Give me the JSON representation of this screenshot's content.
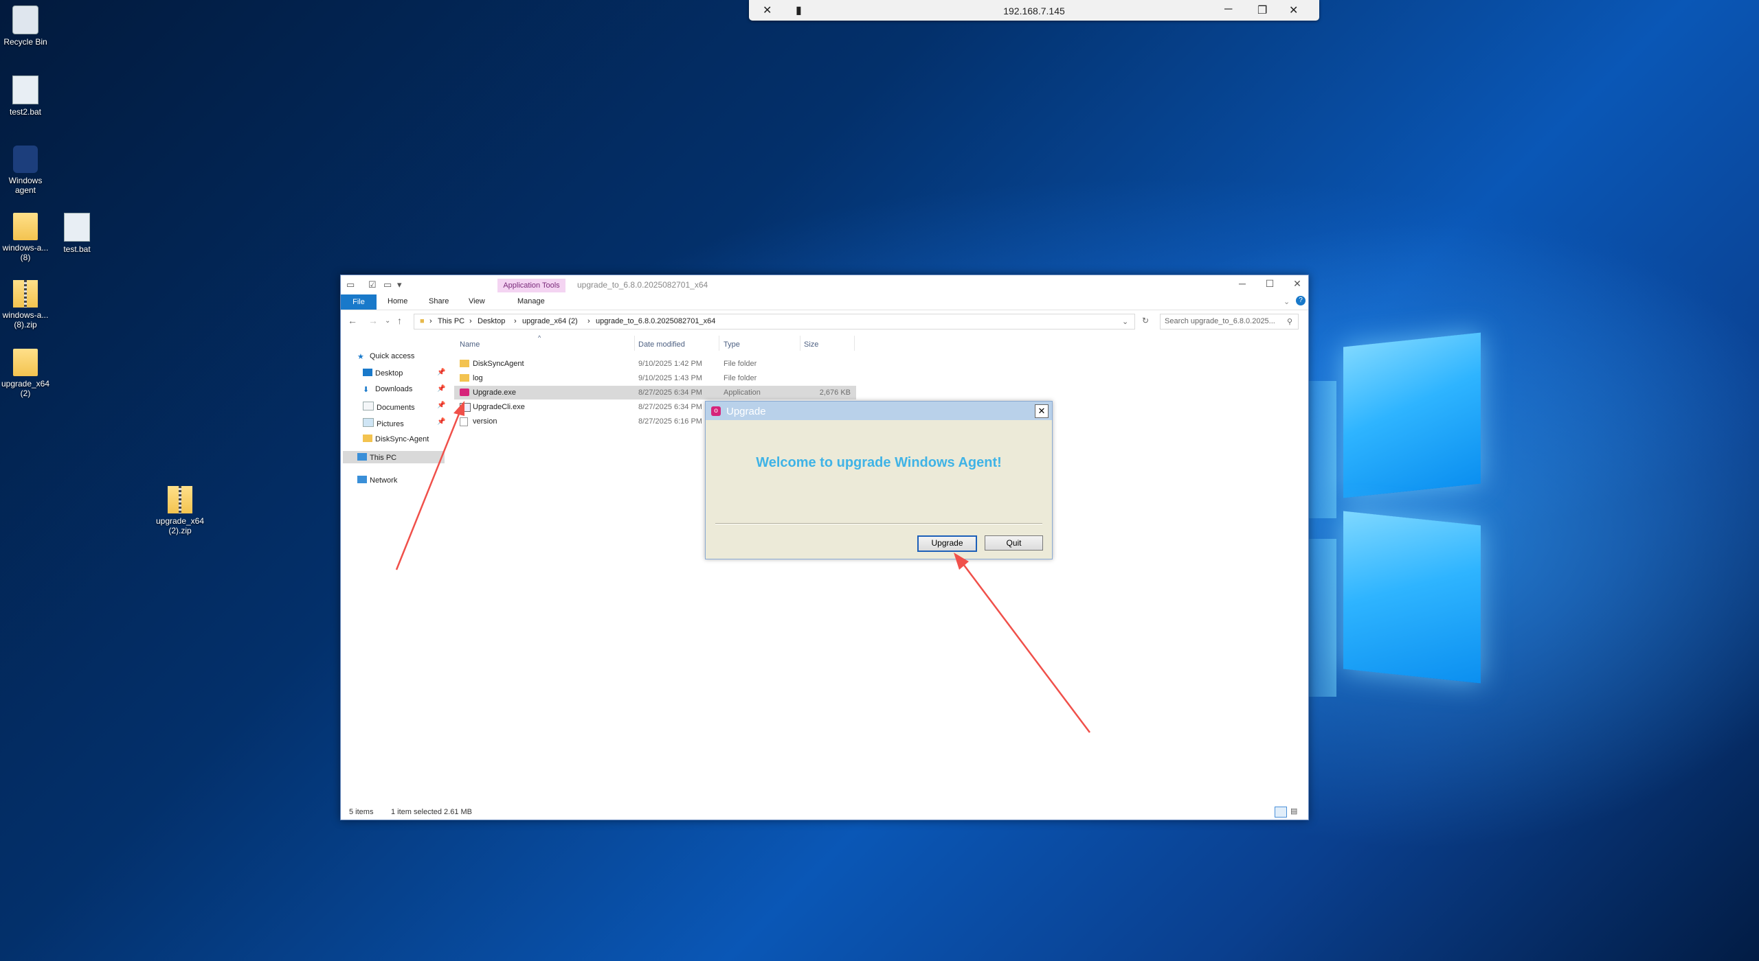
{
  "remote_bar": {
    "address": "192.168.7.145",
    "icons": [
      "pin-off-icon",
      "signal-icon",
      "minimize-icon",
      "restore-icon",
      "close-icon"
    ]
  },
  "desktop_icons": [
    {
      "name": "recycle-bin",
      "label": "Recycle Bin",
      "icon": "recycle-bin-icon"
    },
    {
      "name": "test2-bat",
      "label": "test2.bat",
      "icon": "batch-file-icon"
    },
    {
      "name": "windows-agent",
      "label": "Windows agent",
      "icon": "windows-agent-icon"
    },
    {
      "name": "windows-a-8",
      "label": "windows-a... (8)",
      "icon": "folder-icon"
    },
    {
      "name": "test-bat",
      "label": "test.bat",
      "icon": "batch-file-icon"
    },
    {
      "name": "windows-a-8-zip",
      "label": "windows-a... (8).zip",
      "icon": "zip-icon"
    },
    {
      "name": "upgrade-x64-2",
      "label": "upgrade_x64 (2)",
      "icon": "folder-icon"
    },
    {
      "name": "upgrade-x64-2-zip",
      "label": "upgrade_x64 (2).zip",
      "icon": "zip-icon"
    }
  ],
  "explorer": {
    "context_tab": "Application Tools",
    "title": "upgrade_to_6.8.0.2025082701_x64",
    "ribbon_tabs": [
      "File",
      "Home",
      "Share",
      "View",
      "Manage"
    ],
    "breadcrumb": [
      "This PC",
      "Desktop",
      "upgrade_x64 (2)",
      "upgrade_to_6.8.0.2025082701_x64"
    ],
    "search_placeholder": "Search upgrade_to_6.8.0.2025...",
    "nav": {
      "quick_access": "Quick access",
      "items": [
        "Desktop",
        "Downloads",
        "Documents",
        "Pictures",
        "DiskSync-Agent"
      ],
      "this_pc": "This PC",
      "network": "Network"
    },
    "columns": [
      "Name",
      "Date modified",
      "Type",
      "Size"
    ],
    "files": [
      {
        "name": "DiskSyncAgent",
        "date": "9/10/2025 1:42 PM",
        "type": "File folder",
        "size": ""
      },
      {
        "name": "log",
        "date": "9/10/2025 1:43 PM",
        "type": "File folder",
        "size": ""
      },
      {
        "name": "Upgrade.exe",
        "date": "8/27/2025 6:34 PM",
        "type": "Application",
        "size": "2,676 KB"
      },
      {
        "name": "UpgradeCli.exe",
        "date": "8/27/2025 6:34 PM",
        "type": "",
        "size": ""
      },
      {
        "name": "version",
        "date": "8/27/2025 6:16 PM",
        "type": "",
        "size": ""
      }
    ],
    "status": {
      "count": "5 items",
      "selection": "1 item selected  2.61 MB"
    }
  },
  "dialog": {
    "title": "Upgrade",
    "message": "Welcome to upgrade Windows Agent!",
    "upgrade_button": "Upgrade",
    "quit_button": "Quit"
  },
  "colors": {
    "accent": "#1979ca",
    "annotation_arrow": "#f0504a",
    "welcome_text": "#3fb3e6"
  }
}
